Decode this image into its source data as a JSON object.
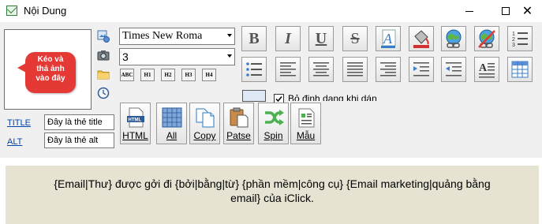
{
  "window": {
    "title": "Nội Dung",
    "controls": [
      "minimize",
      "maximize",
      "close"
    ]
  },
  "drop_zone": {
    "hint_line1": "Kéo và",
    "hint_line2": "thả ảnh",
    "hint_line3": "vào đây"
  },
  "font": {
    "family": "Times New Roma",
    "size": "3"
  },
  "headings": [
    "ABC",
    "H1",
    "H2",
    "H3",
    "H4"
  ],
  "toolbar": {
    "row1": [
      "bold",
      "italic",
      "underline",
      "strikethrough",
      "font-color",
      "fill-color",
      "insert-link",
      "remove-link",
      "numbered-list"
    ],
    "row2": [
      "bullet-list",
      "align-left",
      "align-center",
      "justify",
      "align-right",
      "indent",
      "outdent",
      "text-style",
      "table"
    ],
    "bold_label": "B",
    "italic_label": "I",
    "underline_label": "U",
    "strike_label": "S",
    "text_style_label": "A"
  },
  "keep_format": {
    "label": "Bỏ định dạng khi dán",
    "checked": true
  },
  "attributes": {
    "title_link": "TITLE",
    "title_value": "Đây là thẻ title",
    "alt_link": "ALT",
    "alt_value": "Đây là thẻ alt"
  },
  "bottom_buttons": {
    "html": "HTML",
    "all": "All",
    "copy": "Copy",
    "paste": "Patse",
    "spin": "Spin",
    "template": "Mẫu"
  },
  "preview": {
    "text": "{Email|Thư} được gởi đi {bởi|bằng|từ} {phần mềm|công cụ} {Email marketing|quảng bằng email} của iClick."
  },
  "colors": {
    "preview_bg": "#e6e3d3",
    "bubble": "#e53935",
    "link": "#0645ad",
    "panel_bg": "#f0f0f0"
  }
}
